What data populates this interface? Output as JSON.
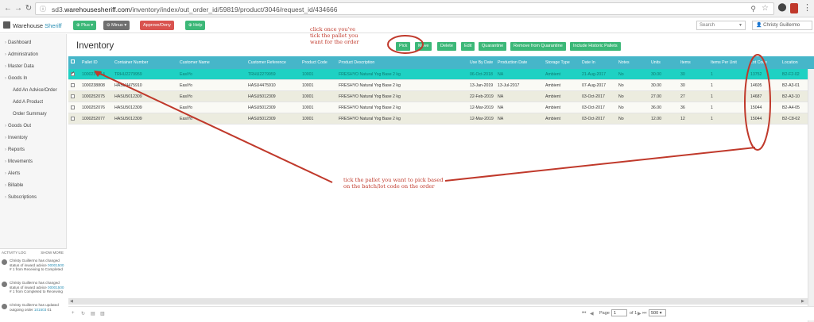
{
  "browser": {
    "url_prefix": "sd3.",
    "url_domain": "warehousesheriff.com",
    "url_path": "/inventory/index/out_order_id/59819/product/3046/request_id/434666"
  },
  "header": {
    "brand_first": "Warehouse",
    "brand_second": "Sheriff",
    "plus_label": "⊕ Plus ▾",
    "minus_label": "⊖ Minus ▾",
    "approve_label": "Approve/Deny",
    "help_label": "⊕ Help",
    "search_placeholder": "Search",
    "user_name": "Christy Guillermo"
  },
  "sidebar": {
    "items": [
      {
        "label": "Dashboard"
      },
      {
        "label": "Administration"
      },
      {
        "label": "Master Data"
      },
      {
        "label": "Goods In"
      },
      {
        "label": "Add An Advice/Order"
      },
      {
        "label": "Add A Product"
      },
      {
        "label": "Order Summary"
      },
      {
        "label": "Goods Out"
      },
      {
        "label": "Inventory"
      },
      {
        "label": "Reports"
      },
      {
        "label": "Movements"
      },
      {
        "label": "Alerts"
      },
      {
        "label": "Billable"
      },
      {
        "label": "Subscriptions"
      }
    ],
    "activity_title": "ACTIVITY LOG",
    "activity_more": "SHOW MORE",
    "activity": [
      {
        "text": "Christy Guillermo has changed status of inward advice",
        "link": "00001500",
        "rest": "# 1 from Receiving to Completed"
      },
      {
        "text": "Christy Guillermo has changed status of inward advice",
        "link": "00001500",
        "rest": "# 1 from Completed to Receiving"
      },
      {
        "text": "Christy Guillermo has updated outgoing order",
        "link": "101503",
        "rest": "01"
      }
    ]
  },
  "page": {
    "title": "Inventory",
    "buttons": [
      "Pick",
      "Move",
      "Delete",
      "Edit",
      "Quarantine",
      "Remove from Quarantine",
      "Include Historic Pallets"
    ]
  },
  "table": {
    "columns": [
      "Pallet ID",
      "Container Number",
      "Customer Name",
      "Customer Reference",
      "Product Code",
      "Product Description",
      "Use By Date",
      "Production Date",
      "Storage Type",
      "Date In",
      "Notes",
      "Units",
      "Items",
      "Items Per Unit",
      "Lot Code",
      "Location"
    ],
    "rows": [
      {
        "selected": true,
        "cells": [
          "1000237814",
          "TRHU2279959",
          "EasiYo",
          "TRHU2279959",
          "10001",
          "FRESHYO Natural Yog Base 2 kg",
          "06-Oct-2018",
          "NA",
          "Ambient",
          "21-Aug-2017",
          "No",
          "30.00",
          "30",
          "1",
          "13752",
          "B2-F2-02"
        ]
      },
      {
        "selected": false,
        "cells": [
          "1000238808",
          "HASU4475910",
          "EasiYo",
          "HASU4475910",
          "10001",
          "FRESHYO Natural Yog Base 2 kg",
          "13-Jan-2019",
          "13-Jul-2017",
          "Ambient",
          "07-Aug-2017",
          "No",
          "30.00",
          "30",
          "1",
          "14605",
          "B2-A3-01"
        ]
      },
      {
        "selected": false,
        "cells": [
          "1000252075",
          "HASU5012309",
          "EasiYo",
          "HASU5012309",
          "10001",
          "FRESHYO Natural Yog Base 2 kg",
          "22-Feb-2019",
          "NA",
          "Ambient",
          "03-Oct-2017",
          "No",
          "27.00",
          "27",
          "1",
          "14687",
          "B2-A3-10"
        ]
      },
      {
        "selected": false,
        "cells": [
          "1000252076",
          "HASU5012309",
          "EasiYo",
          "HASU5012309",
          "10001",
          "FRESHYO Natural Yog Base 2 kg",
          "12-Mar-2019",
          "NA",
          "Ambient",
          "03-Oct-2017",
          "No",
          "36.00",
          "36",
          "1",
          "15044",
          "B2-A4-05"
        ]
      },
      {
        "selected": false,
        "cells": [
          "1000252077",
          "HASU5012309",
          "EasiYo",
          "HASU5012309",
          "10001",
          "FRESHYO Natural Yog Base 2 kg",
          "12-Mar-2019",
          "NA",
          "Ambient",
          "03-Oct-2017",
          "No",
          "12.00",
          "12",
          "1",
          "15044",
          "B2-C8-02"
        ]
      }
    ]
  },
  "pager": {
    "page_label": "Page",
    "page_value": "1",
    "of_label": "of 1",
    "per_page": "500"
  },
  "annotations": {
    "top_note_line1": "click once you've",
    "top_note_line2": "tick the pallet you",
    "top_note_line3": "want for the order",
    "bottom_note_line1": "tick the pallet you want to pick based",
    "bottom_note_line2": "on the batch/lot code on the order"
  },
  "colors": {
    "header_teal": "#46b6c9",
    "selected_row": "#1fd1c3",
    "button_green": "#3cb878",
    "annotation_red": "#c0392b"
  }
}
